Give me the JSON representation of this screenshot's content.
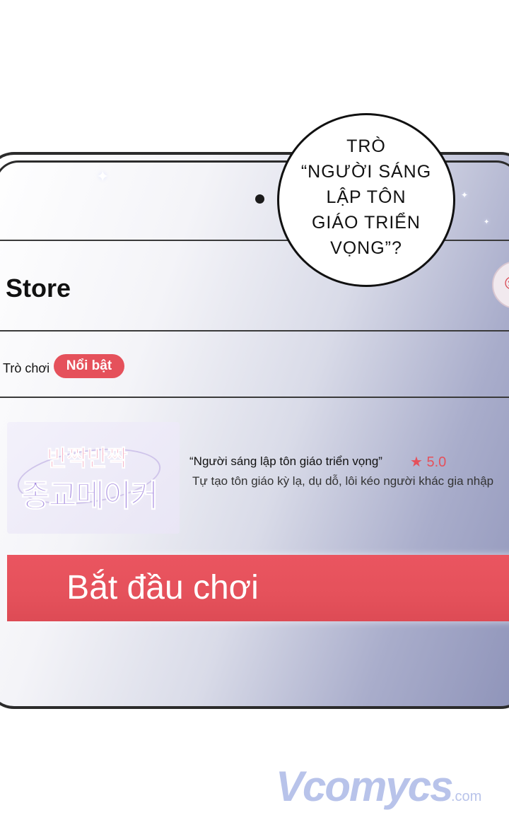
{
  "bubble": {
    "text": "TRÒ\n“NGƯỜI SÁNG\nLẬP TÔN\nGIÁO TRIỂN\nVỌNG”?"
  },
  "store": {
    "title": "Store",
    "tab_label": "Trò chơi",
    "tab_active": "Nổi bật"
  },
  "game": {
    "thumb_logo_top": "반짝반짝",
    "thumb_logo_bottom": "종교메이커",
    "title": "“Người sáng lập tôn giáo triển vọng”",
    "rating_icon": "star-icon",
    "rating": "★ 5.0",
    "description": "Tự tạo tôn giáo kỳ lạ, dụ dỗ, lôi kéo người khác gia nhập"
  },
  "play_button": {
    "label": "Bắt đầu chơi"
  },
  "watermark": {
    "main": "Vcomycs",
    "sub": ".com"
  },
  "colors": {
    "accent": "#e5515b",
    "bezel": "#2b2b2b"
  }
}
